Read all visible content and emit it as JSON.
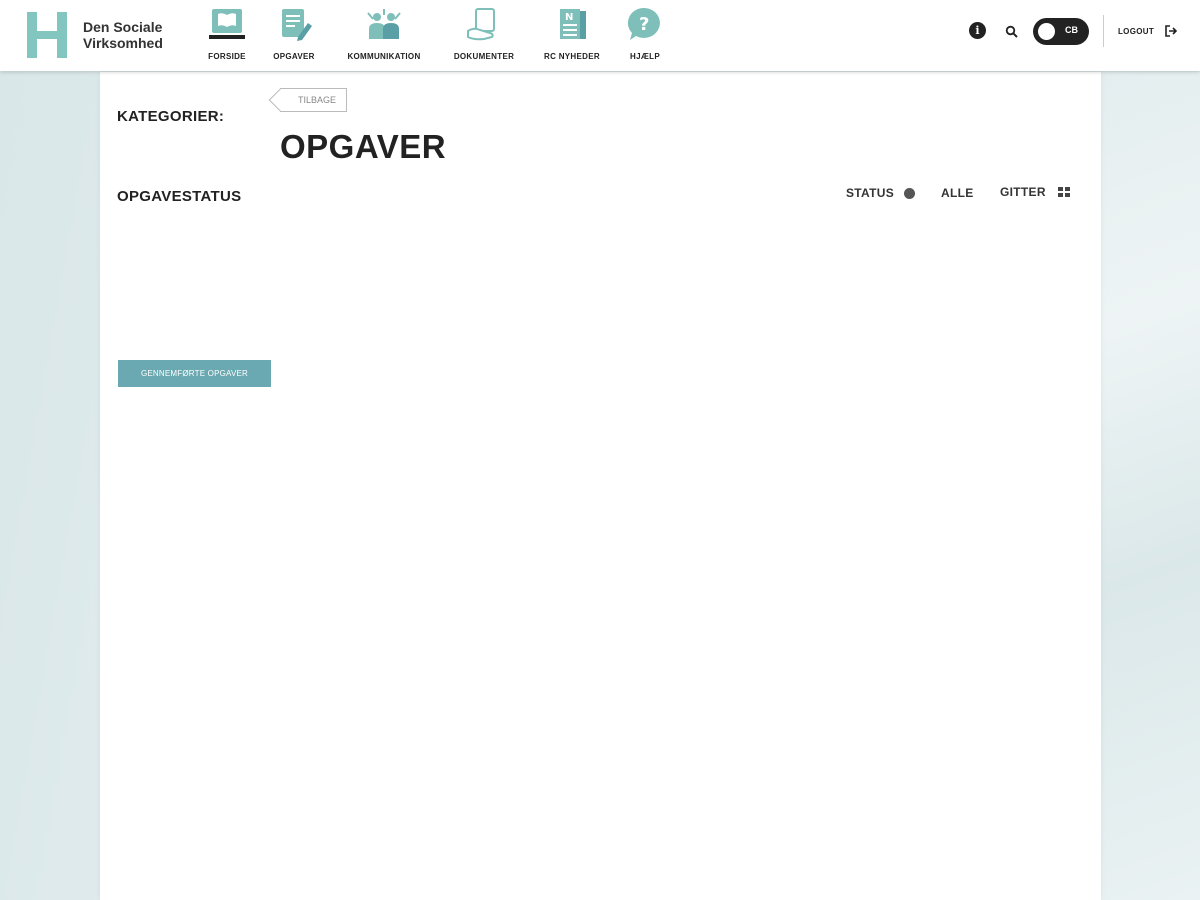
{
  "brand": {
    "name_line1": "Den Sociale",
    "name_line2": "Virksomhed",
    "accent": "#82c6bf"
  },
  "nav": {
    "items": [
      {
        "label": "FORSIDE",
        "icon": "book-icon"
      },
      {
        "label": "OPGAVER",
        "icon": "document-edit-icon"
      },
      {
        "label": "KOMMUNIKATION",
        "icon": "people-icon"
      },
      {
        "label": "DOKUMENTER",
        "icon": "document-hand-icon"
      },
      {
        "label": "RC NYHEDER",
        "icon": "newspaper-icon"
      },
      {
        "label": "HJÆLP",
        "icon": "help-bubble-icon"
      }
    ]
  },
  "header": {
    "toggle_label": "CB",
    "logout_label": "LOGOUT"
  },
  "sidebar": {
    "categories_label": "KATEGORIER:",
    "status_label": "OPGAVESTATUS",
    "completed_button": "GENNEMFØRTE OPGAVER",
    "button_color": "#6aa9b1"
  },
  "main": {
    "back_label": "TILBAGE",
    "title": "OPGAVER",
    "filters": {
      "status": "STATUS",
      "all": "ALLE",
      "grid": "GITTER"
    }
  }
}
